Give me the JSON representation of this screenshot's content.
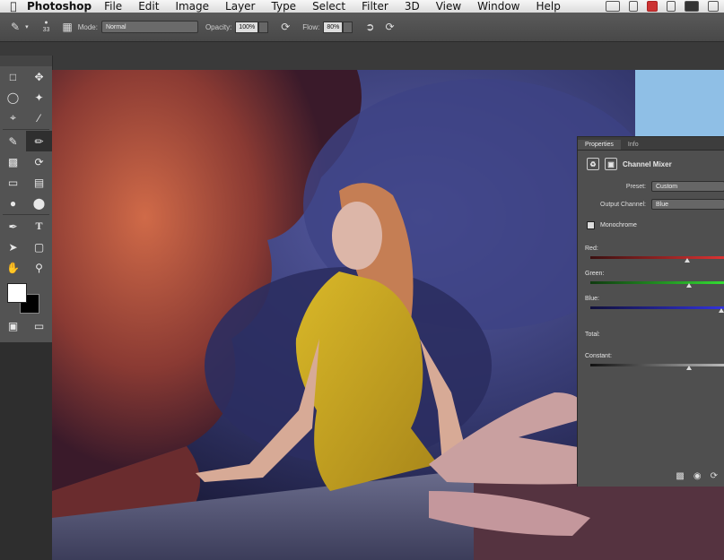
{
  "menubar": {
    "apple": "",
    "app": "Photoshop",
    "items": [
      "File",
      "Edit",
      "Image",
      "Layer",
      "Type",
      "Select",
      "Filter",
      "3D",
      "View",
      "Window",
      "Help"
    ]
  },
  "options": {
    "brush_size": "33",
    "mode_label": "Mode:",
    "mode_value": "Normal",
    "opacity_label": "Opacity:",
    "opacity_value": "100%",
    "flow_label": "Flow:",
    "flow_value": "80%"
  },
  "tools": {
    "items": [
      "marquee-icon",
      "move-icon",
      "lasso-icon",
      "quick-select-icon",
      "crop-icon",
      "eyedropper-icon",
      "healing-icon",
      "brush-icon",
      "stamp-icon",
      "history-brush-icon",
      "eraser-icon",
      "gradient-icon",
      "blur-icon",
      "dodge-icon",
      "pen-icon",
      "type-icon",
      "path-select-icon",
      "shape-icon",
      "hand-icon",
      "zoom-icon"
    ],
    "active_index": 7,
    "foreground_color": "#ffffff",
    "background_color": "#000000"
  },
  "properties": {
    "tabs": [
      "Properties",
      "Info"
    ],
    "active_tab": 0,
    "title": "Channel Mixer",
    "preset_label": "Preset:",
    "preset_value": "Custom",
    "output_label": "Output Channel:",
    "output_value": "Blue",
    "monochrome_label": "Monochrome",
    "sliders": [
      {
        "label": "Red:",
        "value_fraction": 0.72,
        "color": "#c33"
      },
      {
        "label": "Green:",
        "value_fraction": 0.73,
        "color": "#3c3"
      },
      {
        "label": "Blue:",
        "value_fraction": 1.0,
        "color": "#33c"
      }
    ],
    "total_label": "Total:",
    "constant_label": "Constant:",
    "constant_fraction": 0.73
  },
  "colors": {
    "accent_red": "#c33333",
    "accent_green": "#33c333",
    "accent_blue": "#3333cc",
    "dress": "#c9a920",
    "foliage_red": "#c0543a",
    "foliage_blue": "#3a3c7a"
  }
}
